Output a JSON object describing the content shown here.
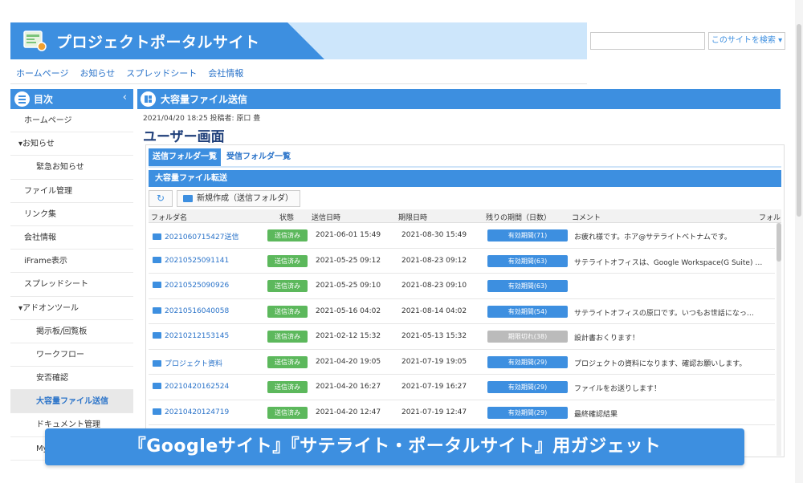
{
  "header": {
    "site_title": "プロジェクトポータルサイト"
  },
  "search": {
    "button_label": "このサイトを検索 ▾"
  },
  "topnav": [
    "ホームページ",
    "お知らせ",
    "スプレッドシート",
    "会社情報"
  ],
  "sidebar": {
    "title": "目次",
    "items": [
      {
        "label": "ホームページ",
        "level": 1
      },
      {
        "label": "▾お知らせ",
        "level": 0
      },
      {
        "label": "緊急お知らせ",
        "level": 2
      },
      {
        "label": "ファイル管理",
        "level": 1
      },
      {
        "label": "リンク集",
        "level": 1
      },
      {
        "label": "会社情報",
        "level": 1
      },
      {
        "label": "iFrame表示",
        "level": 1
      },
      {
        "label": "スプレッドシート",
        "level": 1
      },
      {
        "label": "▾アドオンツール",
        "level": 0
      },
      {
        "label": "掲示板/回覧板",
        "level": 2
      },
      {
        "label": "ワークフロー",
        "level": 2
      },
      {
        "label": "安否確認",
        "level": 2
      },
      {
        "label": "大容量ファイル送信",
        "level": 2,
        "active": true
      },
      {
        "label": "ドキュメント管理",
        "level": 2
      },
      {
        "label": "My",
        "level": 2
      }
    ]
  },
  "main": {
    "header_title": "大容量ファイル送信",
    "meta": "2021/04/20 18:25 投稿者: 原口 豊",
    "page_title": "ユーザー画面",
    "tabs": [
      {
        "label": "送信フォルダ一覧",
        "active": true
      },
      {
        "label": "受信フォルダ一覧",
        "active": false
      }
    ],
    "section_title": "大容量ファイル転送",
    "new_button_label": "新規作成（送信フォルダ）",
    "columns": [
      "フォルダ名",
      "状態",
      "送信日時",
      "期限日時",
      "残りの期間（日数）",
      "コメント",
      "フォル"
    ],
    "rows": [
      {
        "folder": "2021060715427送信",
        "status": "送信済み",
        "sent": "2021-06-01 15:49",
        "expires": "2021-08-30 15:49",
        "remaining": "有効期間(71)",
        "expired": false,
        "comment": "お疲れ様です。ホア@サテライトベトナムです。"
      },
      {
        "folder": "20210525091141",
        "status": "送信済み",
        "sent": "2021-05-25 09:12",
        "expires": "2021-08-23 09:12",
        "remaining": "有効期間(63)",
        "expired": false,
        "comment": "サテライトオフィスは、Google Workspace(G Suite) …"
      },
      {
        "folder": "20210525090926",
        "status": "送信済み",
        "sent": "2021-05-25 09:10",
        "expires": "2021-08-23 09:10",
        "remaining": "有効期間(63)",
        "expired": false,
        "comment": ""
      },
      {
        "folder": "20210516040058",
        "status": "送信済み",
        "sent": "2021-05-16 04:02",
        "expires": "2021-08-14 04:02",
        "remaining": "有効期間(54)",
        "expired": false,
        "comment": "サテライトオフィスの原口です。いつもお世話になっ…"
      },
      {
        "folder": "20210212153145",
        "status": "送信済み",
        "sent": "2021-02-12 15:32",
        "expires": "2021-05-13 15:32",
        "remaining": "期限切れ(38)",
        "expired": true,
        "comment": "設計書おくります！"
      },
      {
        "folder": "プロジェクト資料",
        "status": "送信済み",
        "sent": "2021-04-20 19:05",
        "expires": "2021-07-19 19:05",
        "remaining": "有効期間(29)",
        "expired": false,
        "comment": "プロジェクトの資料になります、確認お願いします。"
      },
      {
        "folder": "20210420162524",
        "status": "送信済み",
        "sent": "2021-04-20 16:27",
        "expires": "2021-07-19 16:27",
        "remaining": "有効期間(29)",
        "expired": false,
        "comment": "ファイルをお送りします！"
      },
      {
        "folder": "20210420124719",
        "status": "送信済み",
        "sent": "2021-04-20 12:47",
        "expires": "2021-07-19 12:47",
        "remaining": "有効期間(29)",
        "expired": false,
        "comment": "最終確認結果"
      }
    ]
  },
  "overlay_caption": "『Googleサイト』『サテライト・ポータルサイト』用ガジェット",
  "colors": {
    "accent": "#3d8fe0",
    "status_green": "#5cb85c",
    "expired_gray": "#bbbbbb"
  }
}
